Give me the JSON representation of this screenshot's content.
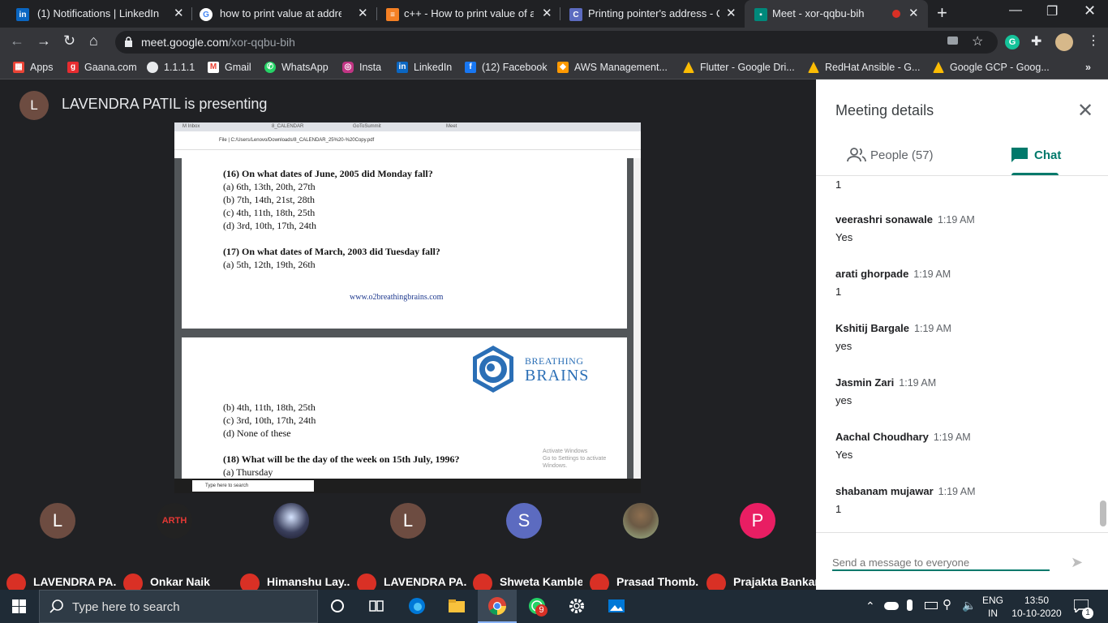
{
  "tabs": [
    {
      "label": "(1) Notifications | LinkedIn",
      "icon": "linkedin-icon",
      "color": "#0a66c2"
    },
    {
      "label": "how to print value at address in",
      "icon": "google-icon",
      "color": "#ffffff"
    },
    {
      "label": "c++ - How to print value of a V",
      "icon": "stackoverflow-icon",
      "color": "#f48024"
    },
    {
      "label": "Printing pointer's address - C+",
      "icon": "cplusplus-icon",
      "color": "#5c6bc0"
    },
    {
      "label": "Meet - xor-qqbu-bih",
      "icon": "meet-icon",
      "color": "#00897b"
    }
  ],
  "url": {
    "host": "meet.google.com",
    "path": "/xor-qqbu-bih"
  },
  "bookmarks": [
    "Apps",
    "Gaana.com",
    "1.1.1.1",
    "Gmail",
    "WhatsApp",
    "Insta",
    "LinkedIn",
    "(12) Facebook",
    "AWS Management...",
    "Flutter - Google Dri...",
    "RedHat Ansible - G...",
    "Google GCP - Goog..."
  ],
  "presenter": {
    "initial": "L",
    "text": "LAVENDRA PATIL is presenting"
  },
  "shared": {
    "url": "File | C:/Users/Lenovo/Downloads/8_CALENDAR_25%20-%20Copy.pdf",
    "page1": [
      "(16) On what dates of June, 2005 did Monday fall?",
      "(a) 6th, 13th, 20th, 27th",
      "(b) 7th, 14th, 21st, 28th",
      "(c) 4th, 11th, 18th, 25th",
      "(d) 3rd, 10th, 17th, 24th",
      "(17) On what dates of March, 2003 did Tuesday fall?",
      "(a) 5th, 12th, 19th, 26th"
    ],
    "site": "www.o2breathingbrains.com",
    "logo_top": "BREATHING",
    "logo_bottom": "BRAINS",
    "page2": [
      "(b) 4th, 11th, 18th, 25th",
      "(c) 3rd, 10th, 17th, 24th",
      "(d) None of these",
      "(18) What will be the day of the week on 15th July, 1996?",
      "(a) Thursday"
    ],
    "activate": "Activate Windows",
    "activate_sub": "Go to Settings to activate Windows.",
    "search": "Type here to search"
  },
  "participants": [
    {
      "initial": "L",
      "name": "LAVENDRA PA...",
      "color": "#6d4c41"
    },
    {
      "initial": "ARTH",
      "name": "Onkar Naik",
      "color": "#222222"
    },
    {
      "initial": "",
      "name": "Himanshu Lay...",
      "color": "#3a3f5c"
    },
    {
      "initial": "L",
      "name": "LAVENDRA PA...",
      "color": "#6d4c41"
    },
    {
      "initial": "S",
      "name": "Shweta Kamble",
      "color": "#5c6bc0"
    },
    {
      "initial": "",
      "name": "Prasad Thomb...",
      "color": "#7a8f6a"
    },
    {
      "initial": "P",
      "name": "Prajakta Bankar",
      "color": "#e91e63"
    }
  ],
  "panel": {
    "title": "Meeting details",
    "people_tab": "People (57)",
    "chat_tab": "Chat",
    "first_line": "1",
    "messages": [
      {
        "who": "veerashri sonawale",
        "time": "1:19 AM",
        "text": "Yes"
      },
      {
        "who": "arati ghorpade",
        "time": "1:19 AM",
        "text": "1"
      },
      {
        "who": "Kshitij Bargale",
        "time": "1:19 AM",
        "text": "yes"
      },
      {
        "who": "Jasmin Zari",
        "time": "1:19 AM",
        "text": "yes"
      },
      {
        "who": "Aachal Choudhary",
        "time": "1:19 AM",
        "text": "Yes"
      },
      {
        "who": "shabanam mujawar",
        "time": "1:19 AM",
        "text": "1"
      }
    ],
    "compose_placeholder": "Send a message to everyone"
  },
  "taskbar": {
    "search": "Type here to search",
    "lang1": "ENG",
    "lang2": "IN",
    "time": "13:50",
    "date": "10-10-2020",
    "whatsapp_badge": "9",
    "notif": "1"
  }
}
